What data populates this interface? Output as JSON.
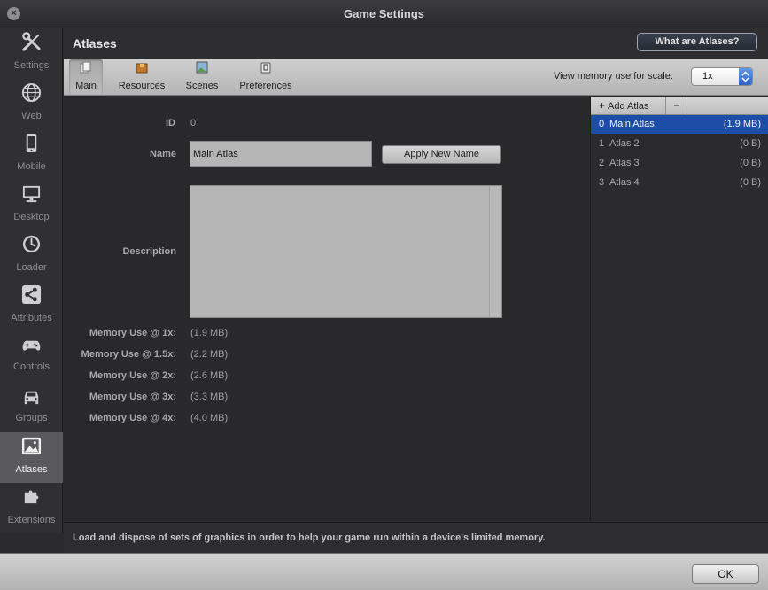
{
  "window": {
    "title": "Game Settings"
  },
  "sidebar": {
    "items": [
      {
        "label": "Settings",
        "icon": "wrench-screwdriver-icon"
      },
      {
        "label": "Web",
        "icon": "globe-icon"
      },
      {
        "label": "Mobile",
        "icon": "phone-icon"
      },
      {
        "label": "Desktop",
        "icon": "monitor-icon"
      },
      {
        "label": "Loader",
        "icon": "clock-icon"
      },
      {
        "label": "Attributes",
        "icon": "share-icon"
      },
      {
        "label": "Controls",
        "icon": "gamepad-icon"
      },
      {
        "label": "Groups",
        "icon": "car-icon"
      },
      {
        "label": "Atlases",
        "icon": "image-icon",
        "active": true
      },
      {
        "label": "Extensions",
        "icon": "puzzle-icon"
      }
    ]
  },
  "header": {
    "title": "Atlases",
    "help_button": "What are Atlases?"
  },
  "toolbar": {
    "tabs": [
      {
        "label": "Main",
        "active": true
      },
      {
        "label": "Resources"
      },
      {
        "label": "Scenes"
      },
      {
        "label": "Preferences"
      }
    ],
    "scale_label": "View memory use for scale:",
    "scale_value": "1x"
  },
  "form": {
    "id_label": "ID",
    "id_value": "0",
    "name_label": "Name",
    "name_value": "Main Atlas",
    "apply_button": "Apply New Name",
    "description_label": "Description",
    "memory": [
      {
        "label": "Memory Use @ 1x:",
        "value": "(1.9 MB)"
      },
      {
        "label": "Memory Use @ 1.5x:",
        "value": "(2.2 MB)"
      },
      {
        "label": "Memory Use @ 2x:",
        "value": "(2.6 MB)"
      },
      {
        "label": "Memory Use @ 3x:",
        "value": "(3.3 MB)"
      },
      {
        "label": "Memory Use @ 4x:",
        "value": "(4.0 MB)"
      }
    ]
  },
  "atlas_list": {
    "add_button": "Add Atlas",
    "add_symbol": "+",
    "remove_symbol": "−",
    "rows": [
      {
        "index": "0",
        "name": "Main Atlas",
        "size": "(1.9 MB)",
        "selected": true
      },
      {
        "index": "1",
        "name": "Atlas 2",
        "size": "(0 B)"
      },
      {
        "index": "2",
        "name": "Atlas 3",
        "size": "(0 B)"
      },
      {
        "index": "3",
        "name": "Atlas 4",
        "size": "(0 B)"
      }
    ]
  },
  "footer": {
    "text": "Load and dispose of sets of graphics in order to help your game run within a device's limited memory."
  },
  "bottom": {
    "ok_button": "OK"
  },
  "colors": {
    "selection": "#1c4ea8",
    "sidebar_active": "#5a5a5e",
    "select_arrow": "#2d67c4"
  }
}
